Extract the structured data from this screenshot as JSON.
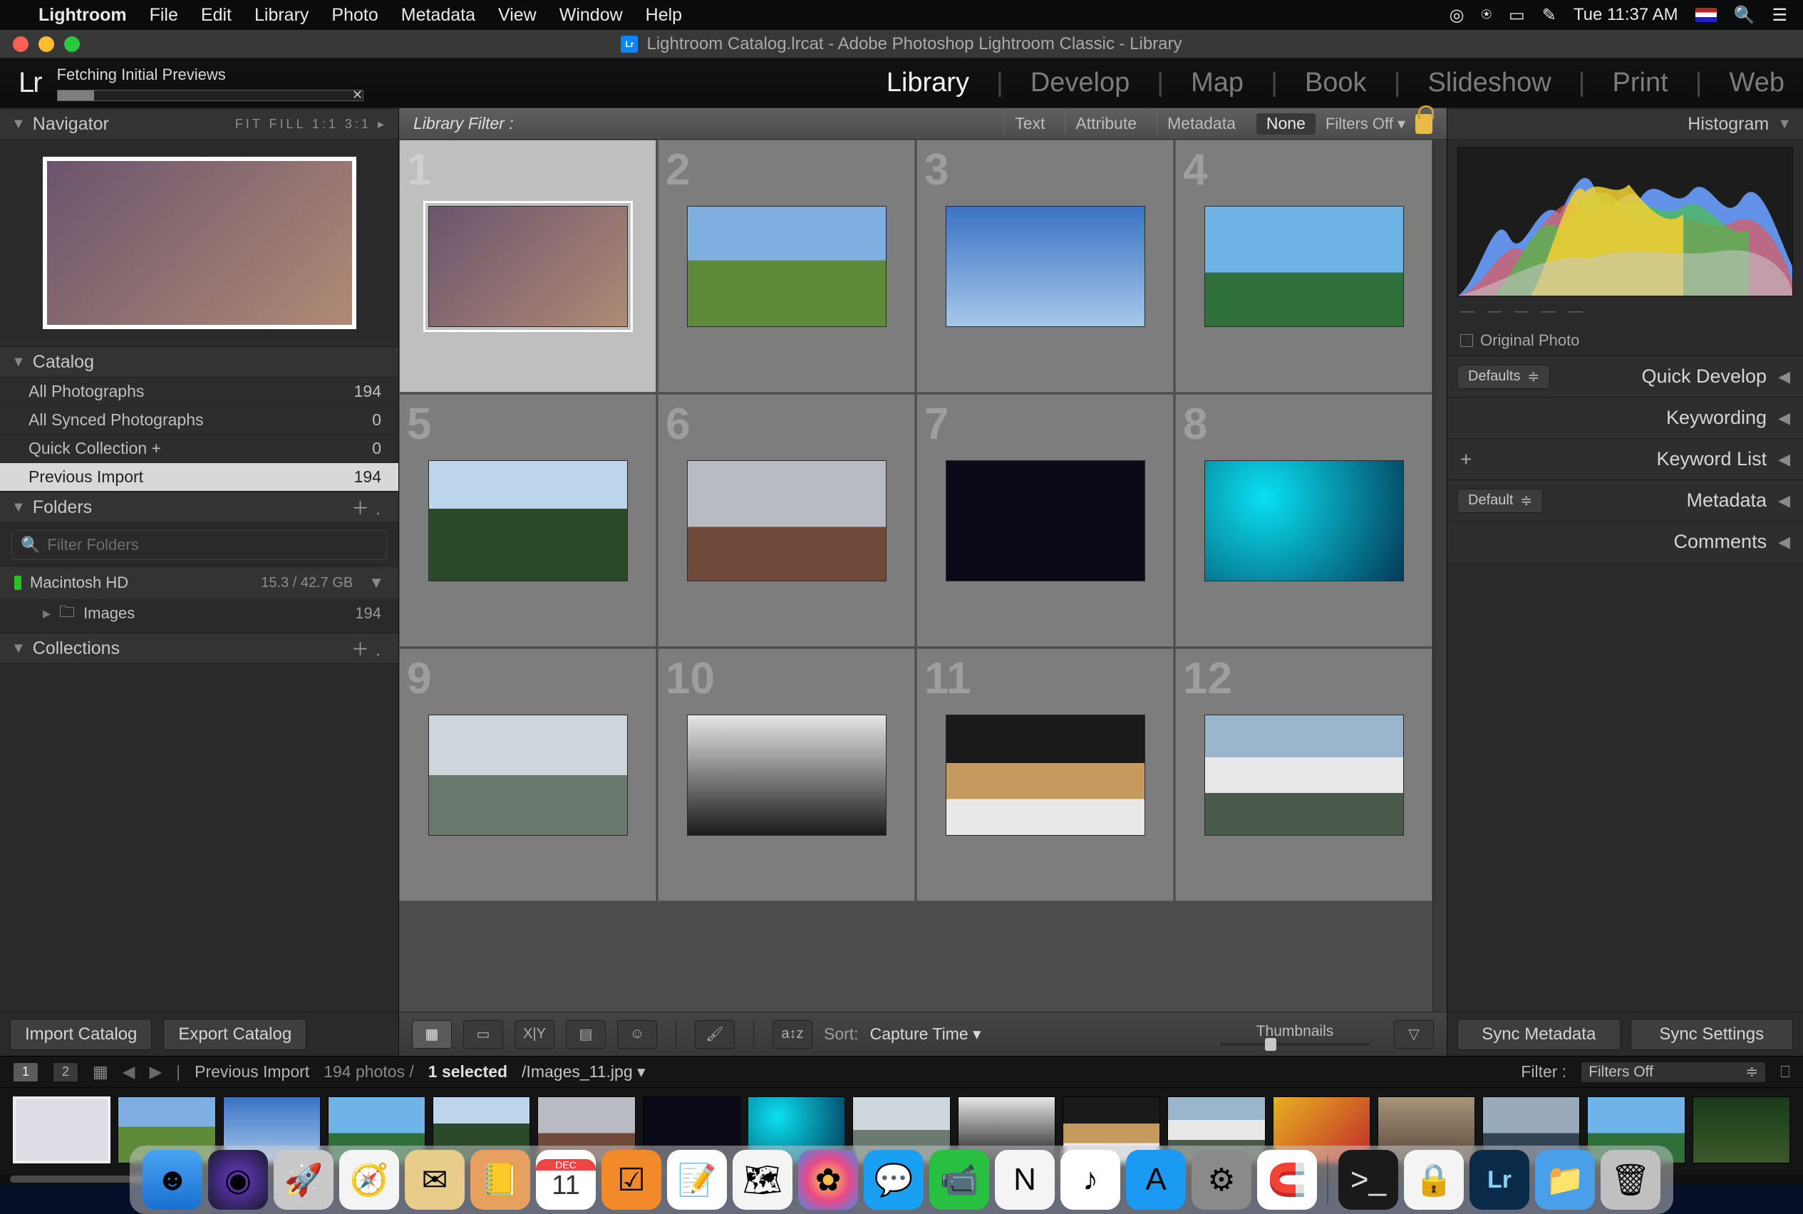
{
  "menubar": {
    "app": "Lightroom",
    "items": [
      "File",
      "Edit",
      "Library",
      "Photo",
      "Metadata",
      "View",
      "Window",
      "Help"
    ],
    "clock": "Tue 11:37 AM"
  },
  "window": {
    "title": "Lightroom Catalog.lrcat - Adobe Photoshop Lightroom Classic - Library"
  },
  "header": {
    "brand": "Lr",
    "status": "Fetching Initial Previews",
    "modules": [
      "Library",
      "Develop",
      "Map",
      "Book",
      "Slideshow",
      "Print",
      "Web"
    ],
    "active_module": "Library"
  },
  "left": {
    "navigator": {
      "title": "Navigator",
      "sizes": "FIT  FILL  1:1  3:1 ▸"
    },
    "catalog": {
      "title": "Catalog",
      "rows": [
        {
          "label": "All Photographs",
          "count": "194"
        },
        {
          "label": "All Synced Photographs",
          "count": "0"
        },
        {
          "label": "Quick Collection  +",
          "count": "0"
        },
        {
          "label": "Previous Import",
          "count": "194",
          "selected": true
        }
      ]
    },
    "folders": {
      "title": "Folders",
      "filter_placeholder": "Filter Folders",
      "volume": {
        "name": "Macintosh HD",
        "space": "15.3 / 42.7 GB"
      },
      "items": [
        {
          "name": "Images",
          "count": "194"
        }
      ]
    },
    "collections": {
      "title": "Collections"
    },
    "buttons": {
      "import": "Import Catalog",
      "export": "Export Catalog"
    }
  },
  "center": {
    "filter": {
      "label": "Library Filter :",
      "items": [
        "Text",
        "Attribute",
        "Metadata",
        "None"
      ],
      "active": "None",
      "status": "Filters Off"
    },
    "grid_numbers": [
      "1",
      "2",
      "3",
      "4",
      "5",
      "6",
      "7",
      "8",
      "9",
      "10",
      "11",
      "12"
    ],
    "toolbar": {
      "sort_label": "Sort:",
      "sort_value": "Capture Time",
      "thumbs_label": "Thumbnails"
    }
  },
  "right": {
    "histogram": {
      "title": "Histogram"
    },
    "original": "Original Photo",
    "defaults": "Defaults",
    "default": "Default",
    "rows": [
      "Quick Develop",
      "Keywording",
      "Keyword List",
      "Metadata",
      "Comments"
    ],
    "sync": {
      "meta": "Sync Metadata",
      "settings": "Sync Settings"
    }
  },
  "filmstrip": {
    "breadcrumb_source": "Previous Import",
    "breadcrumb_stats": "194 photos /",
    "breadcrumb_sel": "1 selected",
    "breadcrumb_file": "/Images_11.jpg ▾",
    "filter_label": "Filter :",
    "filter_value": "Filters Off"
  },
  "dock": {
    "icons": [
      "finder",
      "siri",
      "launchpad",
      "safari",
      "mail",
      "contacts",
      "calendar",
      "reminders",
      "notes",
      "maps",
      "photos",
      "messages",
      "facetime",
      "news",
      "itunes",
      "appstore",
      "settings",
      "magnet"
    ],
    "calendar_day": "11",
    "right": [
      "terminal",
      "1password",
      "lightroom",
      "downloads",
      "trash"
    ]
  }
}
